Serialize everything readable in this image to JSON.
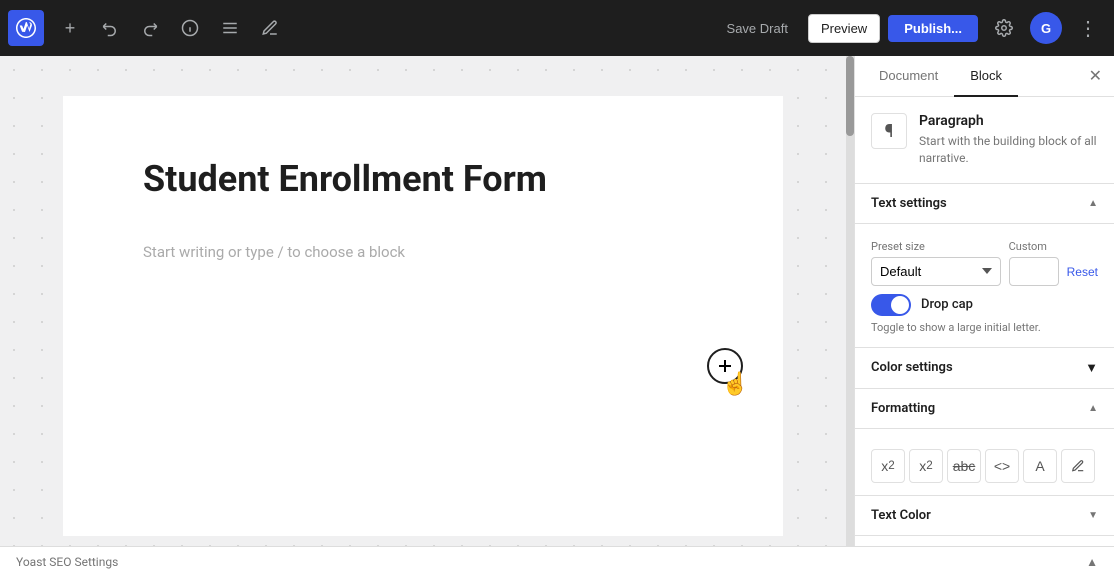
{
  "toolbar": {
    "add_label": "+",
    "undo_label": "↺",
    "redo_label": "↻",
    "info_label": "ℹ",
    "list_label": "☰",
    "edit_label": "✎",
    "save_draft_label": "Save Draft",
    "preview_label": "Preview",
    "publish_label": "Publish...",
    "settings_label": "⚙",
    "avatar_label": "G",
    "more_label": "⋮"
  },
  "editor": {
    "post_title": "Student Enrollment Form",
    "block_placeholder": "Start writing or type / to choose a block"
  },
  "panel": {
    "tab_document": "Document",
    "tab_block": "Block",
    "close_label": "✕",
    "block_icon": "¶",
    "block_name": "Paragraph",
    "block_desc": "Start with the building block of all narrative.",
    "text_settings_label": "Text settings",
    "preset_size_label": "Preset size",
    "custom_label": "Custom",
    "preset_default": "Default",
    "reset_label": "Reset",
    "dropcap_label": "Drop cap",
    "dropcap_hint": "Toggle to show a large initial letter.",
    "color_settings_label": "Color settings",
    "formatting_label": "Formatting",
    "text_color_label": "Text Color",
    "formatting_tools": [
      {
        "key": "superscript",
        "label": "x²"
      },
      {
        "key": "subscript",
        "label": "x₂"
      },
      {
        "key": "strikethrough",
        "label": "abc̶"
      },
      {
        "key": "code",
        "label": "<>"
      },
      {
        "key": "text-style",
        "label": "A"
      },
      {
        "key": "link",
        "label": "🖊"
      }
    ]
  },
  "bottom_bar": {
    "label": "Yoast SEO Settings"
  }
}
